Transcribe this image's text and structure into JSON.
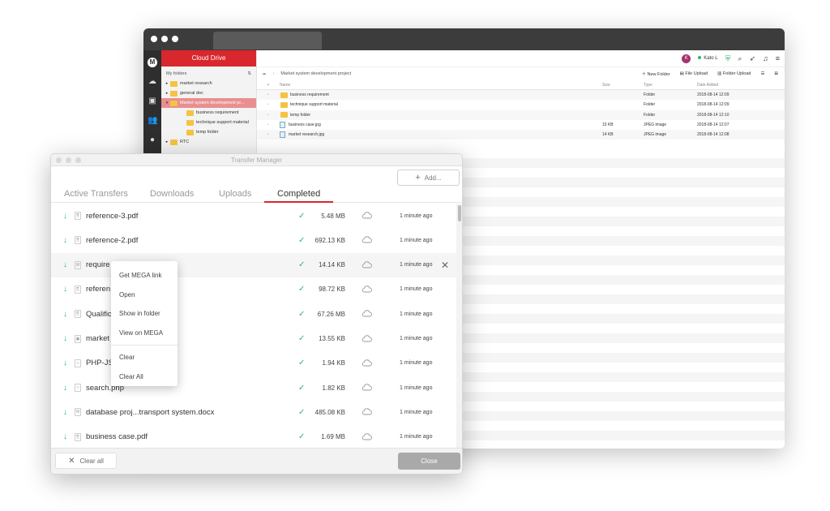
{
  "drive": {
    "brand": "Cloud Drive",
    "my_folders_label": "My folders",
    "tree": [
      {
        "label": "market research",
        "caret": "▸",
        "level": 0,
        "selected": false
      },
      {
        "label": "general doc",
        "caret": "▸",
        "level": 0,
        "selected": false
      },
      {
        "label": "Market system development pr...",
        "caret": "▾",
        "level": 0,
        "selected": true
      },
      {
        "label": "business requirement",
        "caret": "",
        "level": 1,
        "selected": false
      },
      {
        "label": "technique support material",
        "caret": "",
        "level": 1,
        "selected": false
      },
      {
        "label": "temp folder",
        "caret": "",
        "level": 1,
        "selected": false
      },
      {
        "label": "RTC",
        "caret": "▸",
        "level": 0,
        "selected": false
      }
    ],
    "user": {
      "initial": "K",
      "name": "Kato L"
    },
    "breadcrumb": "Market system development project",
    "actions": {
      "new_folder": "New Folder",
      "file_upload": "File Upload",
      "folder_upload": "Folder Upload"
    },
    "columns": {
      "name": "Name",
      "size": "Size",
      "type": "Type",
      "date": "Date Added"
    },
    "files": [
      {
        "name": "business requirement",
        "kind": "folder",
        "size": "",
        "type": "Folder",
        "date": "2018-08-14 12:09"
      },
      {
        "name": "technique support material",
        "kind": "folder",
        "size": "",
        "type": "Folder",
        "date": "2018-08-14 12:09"
      },
      {
        "name": "temp folder",
        "kind": "folder",
        "size": "",
        "type": "Folder",
        "date": "2018-08-14 12:10"
      },
      {
        "name": "business case.jpg",
        "kind": "image",
        "size": "15 KB",
        "type": "JPEG image",
        "date": "2018-08-14 12:07"
      },
      {
        "name": "market research.jpg",
        "kind": "image",
        "size": "14 KB",
        "type": "JPEG image",
        "date": "2018-08-14 12:08"
      }
    ],
    "colors": {
      "brand_red": "#d9272e",
      "selected_row": "#e88f8f",
      "folder": "#f5c342"
    }
  },
  "transfer_manager": {
    "title": "Transfer Manager",
    "add_button": "Add...",
    "tabs": [
      "Active Transfers",
      "Downloads",
      "Uploads",
      "Completed"
    ],
    "active_tab": "Completed",
    "rows": [
      {
        "name": "reference-3.pdf",
        "icon": "pdf",
        "size": "5.48 MB",
        "time": "1 minute ago"
      },
      {
        "name": "reference-2.pdf",
        "icon": "pdf",
        "size": "692.13 KB",
        "time": "1 minute ago"
      },
      {
        "name": "require",
        "icon": "word",
        "size": "14.14 KB",
        "time": "1 minute ago",
        "highlighted": true
      },
      {
        "name": "referen",
        "icon": "pdf",
        "size": "98.72 KB",
        "time": "1 minute ago"
      },
      {
        "name": "Qualific",
        "icon": "pdf",
        "size": "67.26 MB",
        "time": "1 minute ago"
      },
      {
        "name": "market",
        "icon": "image",
        "size": "13.55 KB",
        "time": "1 minute ago"
      },
      {
        "name": "PHP-JS",
        "icon": "code",
        "size": "1.94 KB",
        "time": "1 minute ago"
      },
      {
        "name": "search.php",
        "icon": "code",
        "size": "1.82 KB",
        "time": "1 minute ago"
      },
      {
        "name": "database proj...transport system.docx",
        "icon": "word",
        "size": "485.08 KB",
        "time": "1 minute ago"
      },
      {
        "name": "business case.pdf",
        "icon": "pdf",
        "size": "1.69 MB",
        "time": "1 minute ago"
      }
    ],
    "clear_all_button": "Clear all",
    "close_button": "Close",
    "context_menu": [
      "Get MEGA link",
      "Open",
      "Show in folder",
      "View on MEGA",
      "Clear",
      "Clear All"
    ],
    "colors": {
      "accent": "#d9272e",
      "success": "#36b36b"
    }
  }
}
